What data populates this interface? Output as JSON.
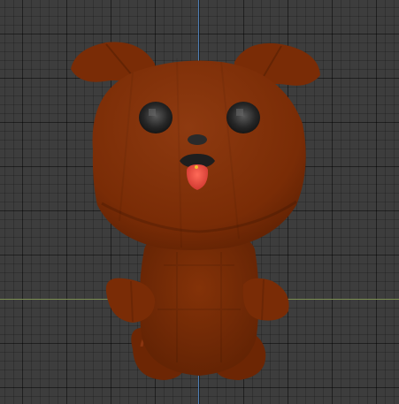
{
  "viewport": {
    "background_color": "#3d3d3d",
    "axis_x_color": "#7c8f52",
    "axis_z_color": "#4f7fb6"
  },
  "model": {
    "body_color": "#7a2c06",
    "body_shadow_color": "#5a1f03",
    "body_highlight_color": "#8e3a10",
    "eye_color": "#1b1b1b",
    "eye_highlight_color": "#6a6a6a",
    "nose_color": "#2a2a2a",
    "tongue_color": "#e8453a"
  }
}
